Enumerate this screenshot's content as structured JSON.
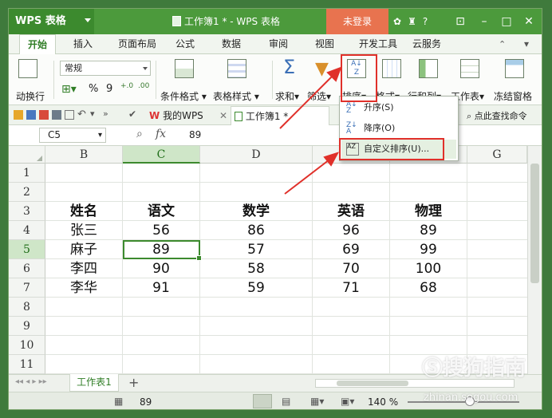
{
  "app": {
    "brand": "WPS 表格",
    "doc_title": "工作簿1 * - WPS 表格",
    "login": "未登录",
    "help": "?"
  },
  "menu": [
    "开始",
    "插入",
    "页面布局",
    "公式",
    "数据",
    "审阅",
    "视图",
    "开发工具",
    "云服务"
  ],
  "ribbon": {
    "auto_wrap": "动换行",
    "number_format": "常规",
    "percent": "%",
    "comma": "9",
    "inc_dec": "+.0",
    "dec_dec": ".00",
    "cond_format": "条件格式",
    "table_style": "表格样式",
    "sum": "求和",
    "filter": "筛选",
    "sort": "排序",
    "format": "格式",
    "row_col": "行和列",
    "worksheet": "工作表",
    "freeze": "冻结窗格"
  },
  "quickbar": {
    "my_wps": "我的WPS",
    "doc_tab": "工作簿1 *",
    "find_cmd": "点此查找命令"
  },
  "formula": {
    "name_box": "C5",
    "fx": "fx",
    "value": "89"
  },
  "columns": [
    "B",
    "C",
    "D",
    "E",
    "F",
    "G"
  ],
  "rows": [
    "1",
    "2",
    "3",
    "4",
    "5",
    "6",
    "7",
    "8",
    "9",
    "10",
    "11"
  ],
  "table": {
    "headers": [
      "姓名",
      "语文",
      "数学",
      "英语",
      "物理"
    ],
    "rows": [
      [
        "张三",
        "56",
        "86",
        "96",
        "89"
      ],
      [
        "麻子",
        "89",
        "57",
        "69",
        "99"
      ],
      [
        "李四",
        "90",
        "58",
        "70",
        "100"
      ],
      [
        "李华",
        "91",
        "59",
        "71",
        "68"
      ]
    ]
  },
  "sort_menu": {
    "asc": "升序(S)",
    "desc": "降序(O)",
    "custom": "自定义排序(U)..."
  },
  "sheet": {
    "tab": "工作表1",
    "add": "+"
  },
  "status": {
    "value": "89",
    "zoom": "140 %"
  },
  "watermark": {
    "site": "搜狗指南",
    "url": "zhinan.sogou.com"
  },
  "colors": {
    "accent": "#3c8a2e",
    "highlight": "#e0302a",
    "login_bg": "#e8734f"
  }
}
